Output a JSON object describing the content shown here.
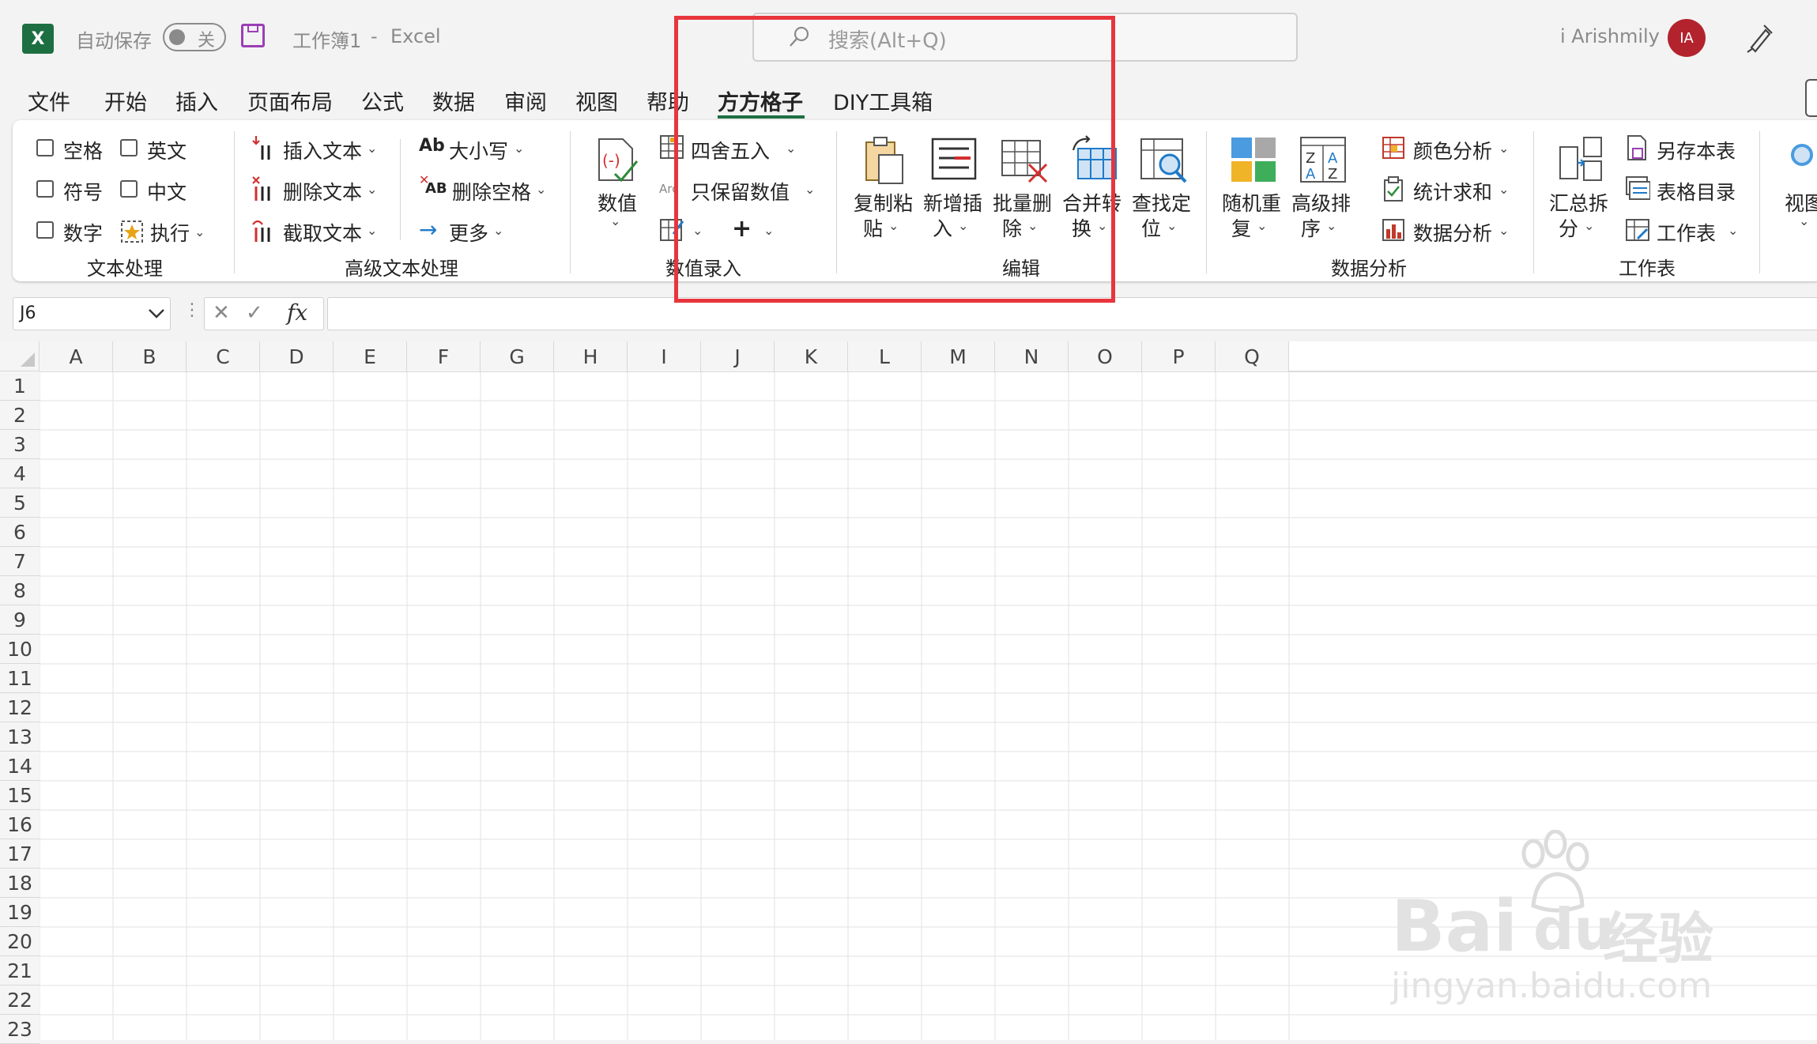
{
  "titlebar": {
    "app_icon_letter": "X",
    "autosave_label": "自动保存",
    "autosave_state": "关",
    "document_title": "工作簿1",
    "title_separator": "-",
    "app_name": "Excel",
    "search_placeholder": "搜索(Alt+Q)",
    "user_name": "i Arishmily",
    "user_initials": "IA"
  },
  "menu": {
    "tabs": [
      "文件",
      "开始",
      "插入",
      "页面布局",
      "公式",
      "数据",
      "审阅",
      "视图",
      "帮助",
      "方方格子",
      "DIY工具箱"
    ],
    "active": "方方格子"
  },
  "ribbon": {
    "text_processing": {
      "checkboxes": [
        "空格",
        "英文",
        "符号",
        "中文",
        "数字"
      ],
      "execute": "执行",
      "group_label": "文本处理"
    },
    "advanced_text": {
      "insert_text": "插入文本",
      "delete_text": "删除文本",
      "extract_text": "截取文本",
      "case_label": "大小写",
      "case_icon": "Ab",
      "delete_space": "删除空格",
      "delete_space_icon": "AB",
      "more": "更多",
      "group_label": "高级文本处理"
    },
    "numeric_entry": {
      "numeric": "数值",
      "round": "四舍五入",
      "keep_numeric": "只保留数值",
      "keep_numeric_icon": "Arc",
      "plus": "+",
      "group_label": "数值录入"
    },
    "edit": {
      "copy_paste": [
        "复制粘",
        "贴"
      ],
      "insert_new": [
        "新增插",
        "入"
      ],
      "batch_delete": [
        "批量删",
        "除"
      ],
      "merge_convert": [
        "合并转",
        "换"
      ],
      "find_locate": [
        "查找定",
        "位"
      ],
      "group_label": "编辑"
    },
    "data_analysis": {
      "random_repeat": [
        "随机重",
        "复"
      ],
      "advanced_sort": [
        "高级排",
        "序"
      ],
      "color_analysis": "颜色分析",
      "stat_sum": "统计求和",
      "data_analysis": "数据分析",
      "group_label": "数据分析"
    },
    "worksheet": {
      "summary_split": [
        "汇总拆",
        "分"
      ],
      "save_as": "另存本表",
      "table_index": "表格目录",
      "worksheet": "工作表",
      "group_label": "工作表"
    },
    "view": {
      "label": "视图"
    }
  },
  "formula_bar": {
    "cell_ref": "J6",
    "cancel_icon": "✕",
    "confirm_icon": "✓",
    "fx": "fx",
    "value": ""
  },
  "grid": {
    "columns": [
      "A",
      "B",
      "C",
      "D",
      "E",
      "F",
      "G",
      "H",
      "I",
      "J",
      "K",
      "L",
      "M",
      "N",
      "O",
      "P",
      "Q"
    ],
    "rows": [
      "1",
      "2",
      "3",
      "4",
      "5",
      "6",
      "7",
      "8",
      "9",
      "10",
      "11",
      "12",
      "13",
      "14",
      "15",
      "16",
      "17",
      "18",
      "19",
      "20",
      "21",
      "22",
      "23"
    ]
  },
  "watermark": {
    "brand": "Bai",
    "brand2": "du",
    "suffix": "经验",
    "url": "jingyan.baidu.com"
  }
}
